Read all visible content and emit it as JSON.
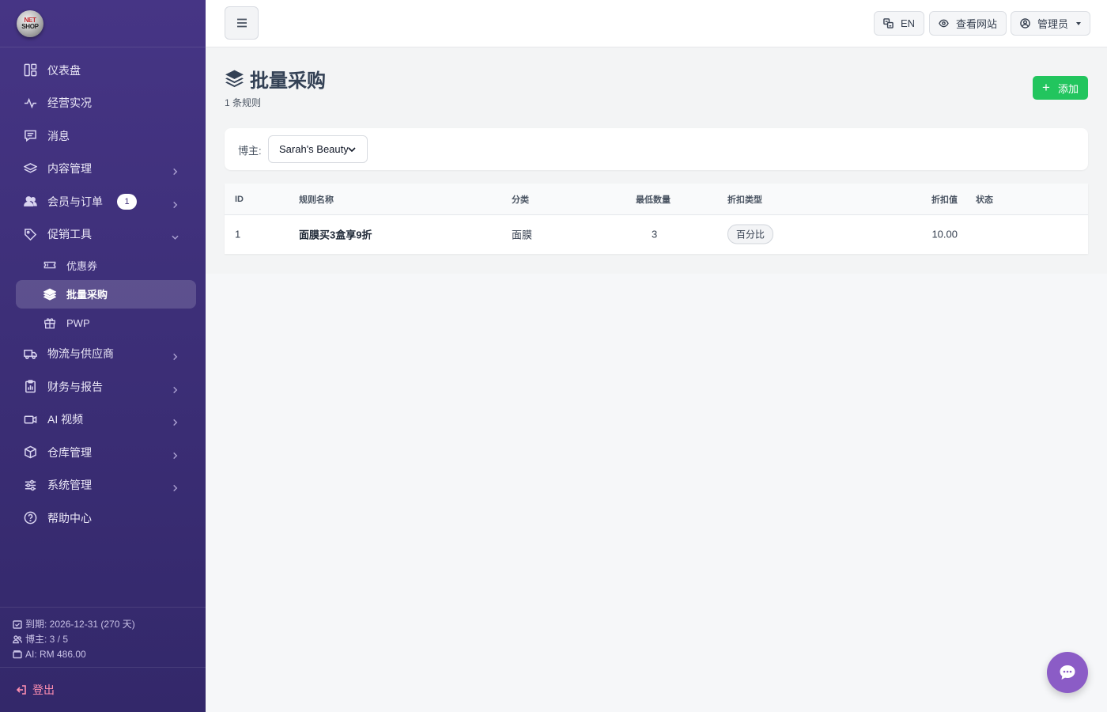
{
  "brand": {
    "logo_top": "NET",
    "logo_bottom": "SHOP"
  },
  "sidebar": {
    "items": [
      {
        "label": "仪表盘",
        "icon": "dashboard-icon",
        "has_children": false
      },
      {
        "label": "经营实况",
        "icon": "activity-icon",
        "has_children": false
      },
      {
        "label": "消息",
        "icon": "message-icon",
        "has_children": false
      },
      {
        "label": "内容管理",
        "icon": "layers-icon",
        "has_children": true
      },
      {
        "label": "会员与订单",
        "icon": "users-icon",
        "has_children": true,
        "badge": "1"
      },
      {
        "label": "促销工具",
        "icon": "tag-icon",
        "has_children": true,
        "expanded": true
      }
    ],
    "sub_items": [
      {
        "label": "优惠券",
        "icon": "ticket-icon"
      },
      {
        "label": "批量采购",
        "icon": "layers-icon",
        "active": true
      },
      {
        "label": "PWP",
        "icon": "gift-icon"
      }
    ],
    "items_after": [
      {
        "label": "物流与供应商",
        "icon": "truck-icon"
      },
      {
        "label": "财务与报告",
        "icon": "report-icon"
      },
      {
        "label": "AI 视频",
        "icon": "video-icon"
      },
      {
        "label": "仓库管理",
        "icon": "box-icon"
      },
      {
        "label": "系统管理",
        "icon": "sliders-icon"
      },
      {
        "label": "帮助中心",
        "icon": "help-icon"
      }
    ],
    "footer": {
      "expiry": "到期: 2026-12-31 (270 天)",
      "bloggers": "博主: 3 / 5",
      "ai_balance": "AI: RM 486.00"
    },
    "logout_label": "登出"
  },
  "topbar": {
    "lang_label": "EN",
    "view_site_label": "查看网站",
    "admin_label": "管理员"
  },
  "page": {
    "title": "批量采购",
    "subtitle": "1 条规则",
    "add_label": "添加"
  },
  "filter": {
    "label": "博主:",
    "selected": "Sarah's Beauty"
  },
  "table": {
    "headers": [
      "ID",
      "规则名称",
      "分类",
      "最低数量",
      "折扣类型",
      "折扣值",
      "状态"
    ],
    "rows": [
      {
        "id": "1",
        "name": "面膜买3盒享9折",
        "category": "面膜",
        "min_qty": "3",
        "discount_type": "百分比",
        "discount_value": "10.00",
        "enabled": true
      }
    ]
  },
  "colors": {
    "sidebar": "#3d2f78",
    "accent": "#5b5bd6",
    "add_button": "#22c55e",
    "logout": "#ff8fb1",
    "chat_fab": "#8b5cc6"
  }
}
